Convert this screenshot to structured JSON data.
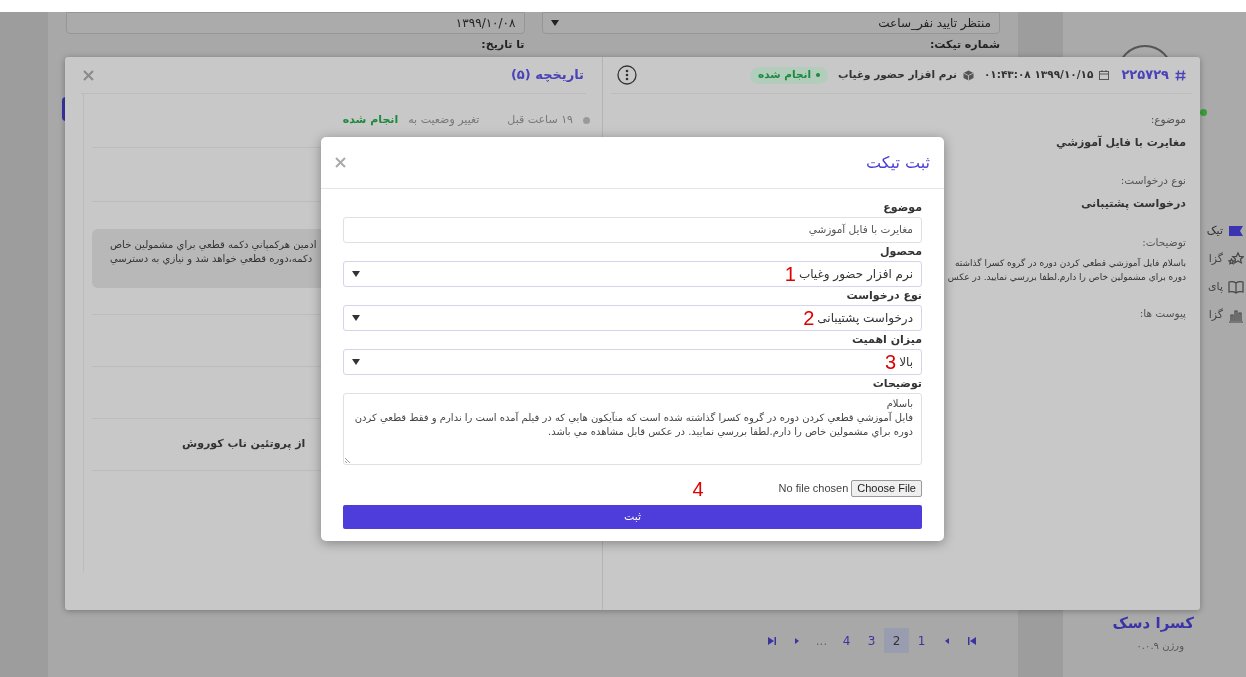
{
  "filters": {
    "fields": [
      {
        "kind": "select",
        "value": "منتظر تایید نفر_ساعت"
      },
      {
        "kind": "input",
        "value": "۱۳۹۹/۱۰/۰۸"
      }
    ],
    "labels": [
      "شماره تیکت:",
      "تا تاریخ:"
    ]
  },
  "pagination": {
    "pages": [
      {
        "label": "1",
        "selected": false
      },
      {
        "label": "2",
        "selected": true
      },
      {
        "label": "3",
        "selected": false
      },
      {
        "label": "4",
        "selected": false
      }
    ],
    "ellipsis": "..."
  },
  "sidebar": {
    "nav": [
      {
        "label": "تیک",
        "selected": true
      },
      {
        "label": "گزا",
        "selected": false
      },
      {
        "label": "پای",
        "selected": false
      },
      {
        "label": "گزا",
        "selected": false
      }
    ],
    "brand": "کسرا دسک",
    "version": "ورژن ۰.۰.۹"
  },
  "history": {
    "title": "تاریخچه (۵)",
    "time": "۱۹ ساعت قبل",
    "action": "تغییر وضعیت به",
    "status": "انجام شده",
    "note_lines": [
      "ادمین هرکمپاني دكمه قطعي براي مشمولين خاص",
      "دكمه،دوره قطعي خواهد شد و نيازي به دسترسي"
    ],
    "author": "از پروتئين ناب كوروش"
  },
  "ticket": {
    "number": "۲۲۵۷۲۹",
    "date": "۱۳۹۹/۱۰/۱۵ ۰۱:۴۳:۰۸",
    "product": "نرم افزار حضور وغیاب",
    "status": "انجام شده",
    "fields": [
      {
        "kind": "value",
        "label": "موضوع:",
        "value": "مغایرت با فایل آموزشي"
      },
      {
        "kind": "value",
        "label": "نوع درخواست:",
        "value": "درخواست پشتیبانی"
      },
      {
        "kind": "lines",
        "label": "توضیحات:",
        "lines": [
          "باسلام فایل آموزشي قطعي کردن دوره در گروه کسرا گذاشته",
          "دوره براي مشمولين خاص را دارم.لطفا بررسي نماييد. در عكس"
        ]
      },
      {
        "kind": "label",
        "label": "پیوست ها:"
      }
    ]
  },
  "modal": {
    "title": "ثبت تیکت",
    "fields": [
      {
        "kind": "input",
        "label": "موضوع",
        "value": "مغایرت با فایل آموزشي"
      },
      {
        "kind": "select",
        "label": "محصول",
        "value": "نرم افزار حضور وغیاب",
        "annotation": "1"
      },
      {
        "kind": "select",
        "label": "نوع درخواست",
        "value": "درخواست پشتیبانی",
        "annotation": "2"
      },
      {
        "kind": "select",
        "label": "میزان اهمیت",
        "value": "بالا",
        "annotation": "3"
      },
      {
        "kind": "textarea",
        "label": "توضیحات",
        "value": "باسلام\nفایل آموزشي قطعي کردن دوره در گروه کسرا گذاشته شده است که منآیکون هايي که در فیلم آمده است را ندارم و فقط قطعي کردن دوره براي مشمولين خاص را دارم.لطفا بررسي نماييد. در عكس قابل مشاهده مي باشد."
      }
    ],
    "file": {
      "button": "Choose File",
      "status": "No file chosen",
      "annotation": "4"
    },
    "submit": "ثبت"
  }
}
